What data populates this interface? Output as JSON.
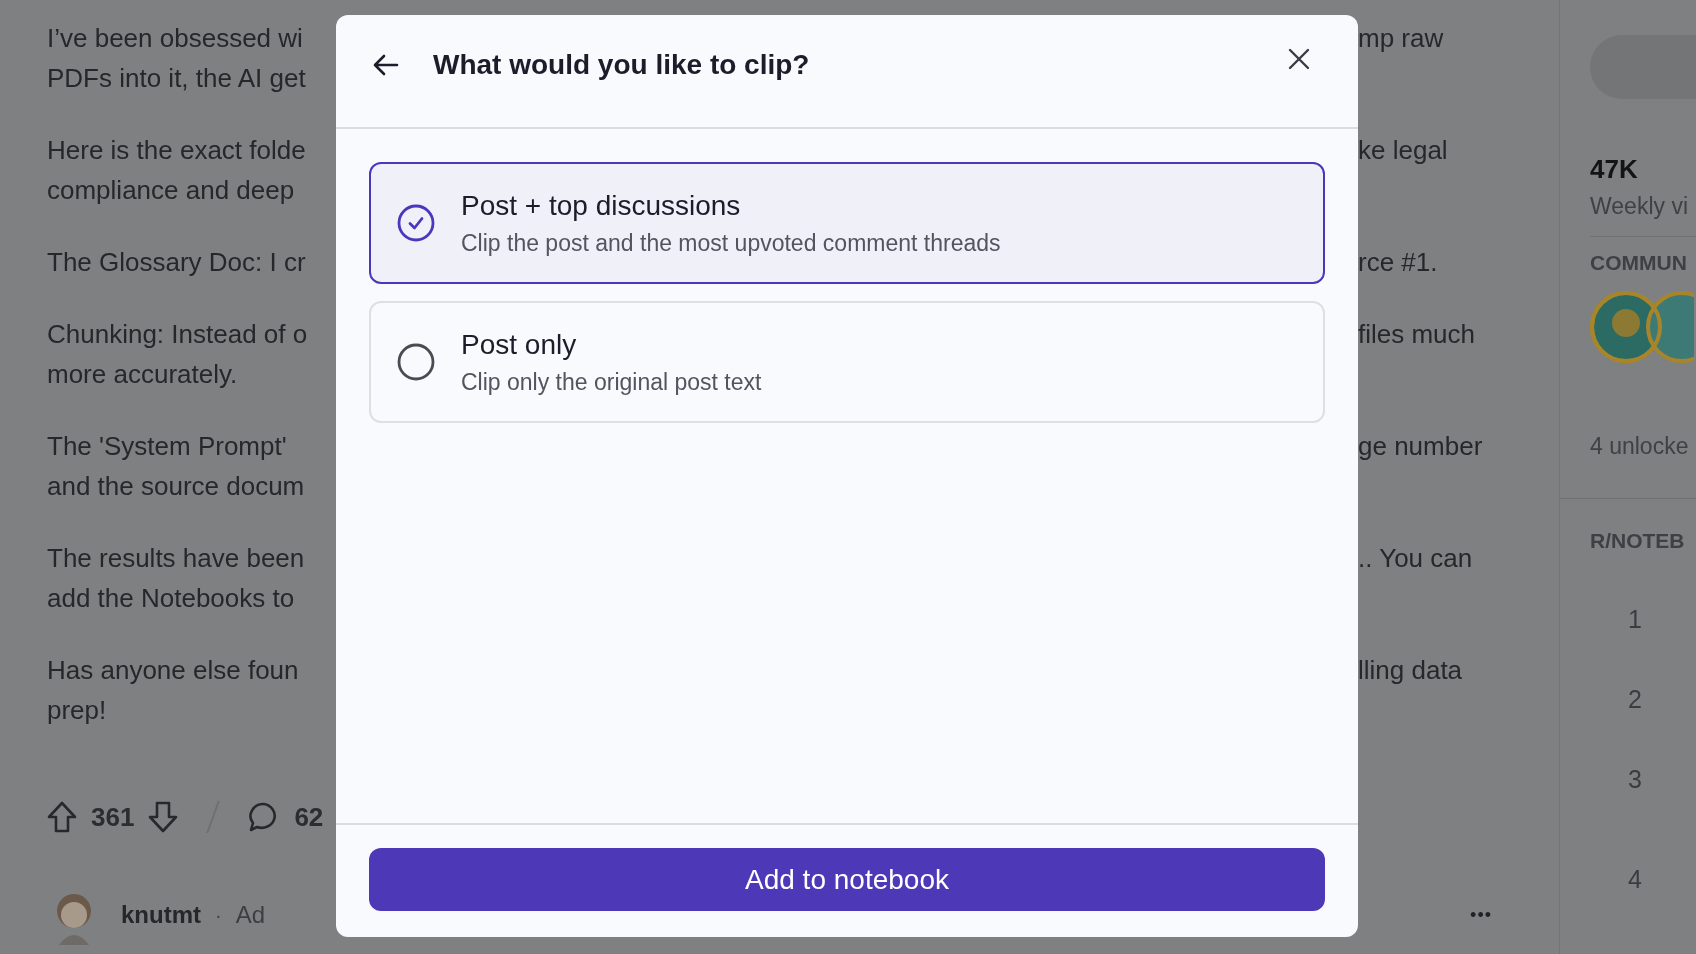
{
  "post": {
    "paragraphs": [
      {
        "lines": [
          {
            "left": "I’ve been obsessed wi",
            "right": "mp raw"
          },
          {
            "left": "PDFs into it, the AI get"
          }
        ]
      },
      {
        "lines": [
          {
            "left": "Here is the exact folde",
            "right": "ke legal"
          },
          {
            "left": "compliance and deep"
          }
        ]
      },
      {
        "lines": [
          {
            "left": "The Glossary Doc: I cr",
            "right": "rce #1."
          }
        ]
      },
      {
        "lines": [
          {
            "left": "Chunking: Instead of o",
            "right": "files much"
          },
          {
            "left": "more accurately."
          }
        ]
      },
      {
        "lines": [
          {
            "left": "The 'System Prompt'",
            "right": "ge number"
          },
          {
            "left": "and the source docum"
          }
        ]
      },
      {
        "lines": [
          {
            "left": "The results have been",
            "right": ".. You can"
          },
          {
            "left": "add the Notebooks to"
          }
        ]
      },
      {
        "lines": [
          {
            "left": "Has anyone else foun",
            "right": "lling data"
          },
          {
            "left": "prep!"
          }
        ]
      }
    ],
    "votes": "361",
    "comments": "62",
    "author": "knutmt",
    "separator": "·",
    "tag": "Ad",
    "more": "•••"
  },
  "sidebar": {
    "stat_value": "47K",
    "stat_label": "Weekly vi",
    "section_1": "COMMUN",
    "achievements": "4 unlocke",
    "section_2": "R/NOTEB",
    "ranks": [
      "1",
      "2",
      "3",
      "4"
    ]
  },
  "dialog": {
    "title": "What would you like to clip?",
    "options": [
      {
        "title": "Post + top discussions",
        "description": "Clip the post and the most upvoted comment threads",
        "selected": true
      },
      {
        "title": "Post only",
        "description": "Clip only the original post text",
        "selected": false
      }
    ],
    "button": "Add to notebook"
  }
}
